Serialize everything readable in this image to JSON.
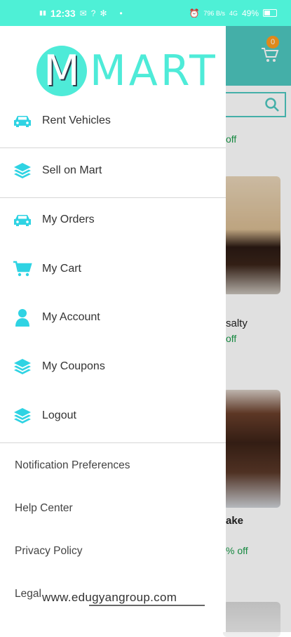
{
  "status_bar": {
    "time": "12:33",
    "left_icons": [
      "signal-icon",
      "message-icon",
      "help-icon",
      "settings-icon"
    ],
    "battery": "49%",
    "speed": "796 B/s",
    "network": "4G"
  },
  "app": {
    "cart_badge": "0",
    "bg_labels": [
      "off",
      "salty",
      "off",
      "ake",
      "% off"
    ]
  },
  "drawer": {
    "logo_initial": "M",
    "logo_text": "MART",
    "menu_primary": [
      {
        "label": "Rent Vehicles",
        "icon": "car-icon"
      }
    ],
    "menu_secondary": [
      {
        "label": "Sell on Mart",
        "icon": "layers-icon"
      }
    ],
    "menu_main": [
      {
        "label": "My Orders",
        "icon": "car-icon"
      },
      {
        "label": "My Cart",
        "icon": "cart-icon"
      },
      {
        "label": "My Account",
        "icon": "person-icon"
      },
      {
        "label": "My Coupons",
        "icon": "layers-icon"
      },
      {
        "label": "Logout",
        "icon": "layers-icon"
      }
    ],
    "links": [
      "Notification Preferences",
      "Help Center",
      "Privacy Policy",
      "Legal"
    ],
    "footer": "www.edugyangroup.com"
  },
  "colors": {
    "accent": "#4eebd8",
    "status_bar": "#4ef0d6",
    "icon": "#2fd3e3",
    "header_bg": "#4ec8c0"
  }
}
